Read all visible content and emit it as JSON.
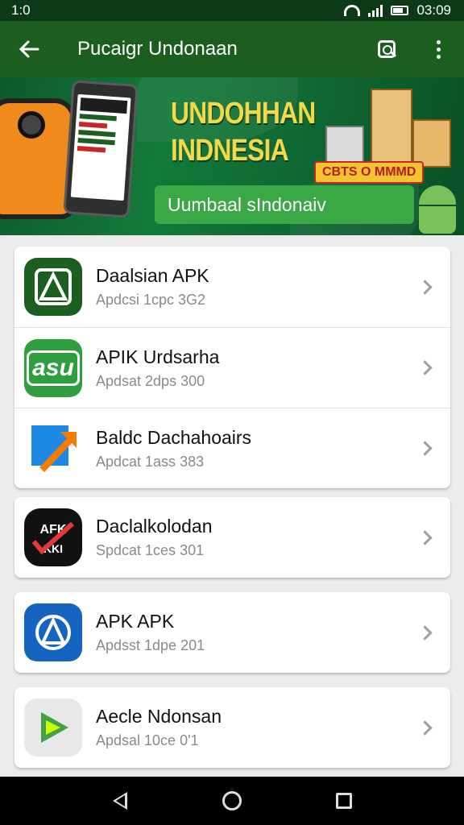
{
  "status": {
    "left": "1:0",
    "time": "03:09",
    "icons": [
      "wifi-icon",
      "signal-icon",
      "battery-icon"
    ]
  },
  "toolbar": {
    "title": "Pucaigr Undonaan",
    "back_icon": "arrow-left-icon",
    "search_icon": "search-icon",
    "menu_icon": "more-vertical-icon"
  },
  "banner": {
    "title_line1": "UNDOHHAN",
    "title_line2": "INDNESIA",
    "badge": "CBTS O MMMD",
    "button_label": "Uumbaal sIndonaiv"
  },
  "lists": [
    {
      "items": [
        {
          "title": "Daalsian APK",
          "subtitle": "Apdcsi 1cpc 3G2",
          "icon": "apk-triangle-icon",
          "icon_bg": "#1b5e20"
        },
        {
          "title": "APIK Urdsarha",
          "subtitle": "Apdsat 2dps 300",
          "icon": "asu-icon",
          "icon_bg": "#2e9e3e",
          "icon_text": "asu"
        },
        {
          "title": "Baldc Dachahoairs",
          "subtitle": "Apdcat 1ass 383",
          "icon": "download-arrow-icon",
          "icon_bg": "#1e88e5"
        }
      ]
    },
    {
      "items": [
        {
          "title": "Daclalkolodan",
          "subtitle": "Spdcat 1ces 301",
          "icon": "check-apk-icon",
          "icon_bg": "#111111",
          "icon_text": "AFKSI"
        }
      ]
    },
    {
      "items": [
        {
          "title": "APK APK",
          "subtitle": "Apdsst 1dpe 201",
          "icon": "apk-triangle-icon",
          "icon_bg": "#1565c0"
        }
      ]
    },
    {
      "items": [
        {
          "title": "Aecle Ndonsan",
          "subtitle": "Apdsal 10ce 0'1",
          "icon": "play-icon",
          "icon_bg": "#e8e8e8"
        }
      ]
    }
  ],
  "navbar": {
    "back": "back-icon",
    "home": "home-icon",
    "recents": "recents-icon"
  }
}
